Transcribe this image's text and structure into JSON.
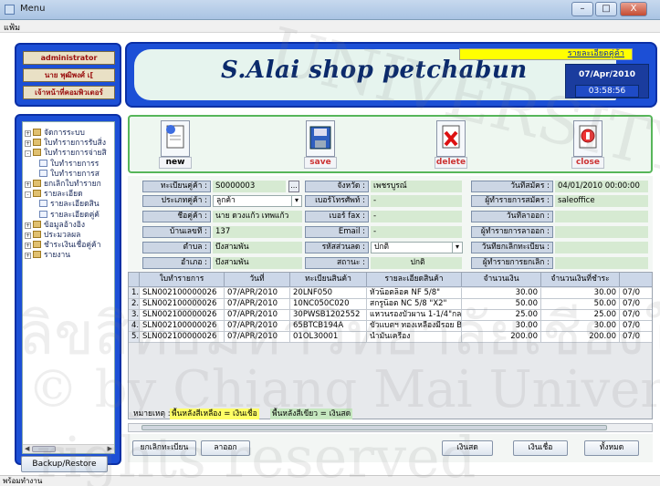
{
  "window": {
    "title": "Menu",
    "menu_item": "แฟ้ม"
  },
  "user_panel": {
    "username": "administrator",
    "fullname": "นาย พุฒิพงศ์ เ[",
    "role": "เจ้าหน้าที่คอมพิวเตอร์"
  },
  "tree": [
    {
      "label": "จัดการระบบ",
      "level": 0,
      "expander": "+",
      "icon": "folder-icon"
    },
    {
      "label": "ใบทำรายการรับสิ่ง",
      "level": 0,
      "expander": "+",
      "icon": "folder-icon"
    },
    {
      "label": "ใบทำรายการจ่ายสิ",
      "level": 0,
      "expander": "-",
      "icon": "folder-icon"
    },
    {
      "label": "ใบทำรายการร",
      "level": 1,
      "expander": "",
      "icon": "document-icon"
    },
    {
      "label": "ใบทำรายการส",
      "level": 1,
      "expander": "",
      "icon": "document-icon"
    },
    {
      "label": "ยกเลิกใบทำรายก",
      "level": 0,
      "expander": "+",
      "icon": "folder-icon"
    },
    {
      "label": "รายละเอียด",
      "level": 0,
      "expander": "-",
      "icon": "folder-icon"
    },
    {
      "label": "รายละเอียดสิน",
      "level": 1,
      "expander": "",
      "icon": "document-icon"
    },
    {
      "label": "รายละเอียดคู่ค้",
      "level": 1,
      "expander": "",
      "icon": "document-icon"
    },
    {
      "label": "ข้อมูลอ้างอิง",
      "level": 0,
      "expander": "+",
      "icon": "folder-icon"
    },
    {
      "label": "ประมวลผล",
      "level": 0,
      "expander": "+",
      "icon": "folder-icon"
    },
    {
      "label": "ชำระเงินเชื่อคู่ค้า",
      "level": 0,
      "expander": "+",
      "icon": "folder-icon"
    },
    {
      "label": "รายงาน",
      "level": 0,
      "expander": "+",
      "icon": "folder-icon"
    }
  ],
  "backup_button": "Backup/Restore",
  "header": {
    "shop_name": "S.Alai shop petchabun",
    "detail_label": "รายละเอียดคู่ค้า",
    "date": "07/Apr/2010",
    "time": "03:58:56"
  },
  "toolbar": {
    "new_label": "new",
    "save_label": "save",
    "delete_label": "delete",
    "close_label": "close"
  },
  "form": {
    "reg_label": "ทะเบียนคู่ค้า :",
    "reg_value": "S0000003",
    "province_label": "จังหวัด :",
    "province_value": "เพชรบูรณ์",
    "apply_date_label": "วันที่สมัคร :",
    "apply_date_value": "04/01/2010 00:00:00",
    "type_label": "ประเภทคู่ค้า :",
    "type_value": "ลูกค้า",
    "phone_label": "เบอร์โทรศัพท์ :",
    "phone_value": "-",
    "apply_by_label": "ผู้ทำรายการสมัคร :",
    "apply_by_value": "saleoffice",
    "name_label": "ชื่อคู่ค้า :",
    "name_value": "นาย ดวงแก้ว เทพแก้ว",
    "fax_label": "เบอร์ fax :",
    "fax_value": "-",
    "leave_date_label": "วันที่ลาออก :",
    "leave_date_value": "",
    "house_no_label": "บ้านเลขที่ :",
    "house_no_value": "137",
    "email_label": "Email :",
    "email_value": "-",
    "leave_by_label": "ผู้ทำรายการลาออก :",
    "leave_by_value": "",
    "subdistrict_label": "ตำบล :",
    "subdistrict_value": "บึงสามพัน",
    "discount_label": "รหัสส่วนลด :",
    "discount_value": "ปกติ",
    "cancel_date_label": "วันที่ยกเลิกทะเบียน :",
    "cancel_date_value": "",
    "district_label": "อำเภอ :",
    "district_value": "บึงสามพัน",
    "status_label": "สถานะ :",
    "status_value": "ปกติ",
    "cancel_by_label": "ผู้ทำรายการยกเลิก :",
    "cancel_by_value": ""
  },
  "grid": {
    "headers": [
      "ใบทำรายการ",
      "วันที่",
      "ทะเบียนสินค้า",
      "รายละเอียดสินค้า",
      "จำนวนเงิน",
      "จำนวนเงินที่ชำระ",
      ""
    ],
    "rows": [
      [
        "1.",
        "SLN002100000026",
        "07/APR/2010",
        "20LNF050",
        "หัวน็อตล็อค NF 5/8\"",
        "30.00",
        "30.00",
        "07/0"
      ],
      [
        "2.",
        "SLN002100000026",
        "07/APR/2010",
        "10NC050C020",
        "สกรูน็อต NC 5/8 \"X2\"",
        "50.00",
        "50.00",
        "07/0"
      ],
      [
        "3.",
        "SLN002100000026",
        "07/APR/2010",
        "30PWSB1202552",
        "แหวนรองบัวผาน 1-1/4\"กลาง",
        "25.00",
        "25.00",
        "07/0"
      ],
      [
        "4.",
        "SLN002100000026",
        "07/APR/2010",
        "65BTCB194A",
        "ขั้วแบตฯ ทองเหลืองมีรอย BHI",
        "30.00",
        "30.00",
        "07/0"
      ],
      [
        "5.",
        "SLN002100000026",
        "07/APR/2010",
        "01OL30001",
        "น้ำมันเครื่อง",
        "200.00",
        "200.00",
        "07/0"
      ]
    ]
  },
  "legend": {
    "note": "หมายเหตุ :",
    "yellow_text": "พื้นหลังสีเหลือง = เงินเชื่อ",
    "green_text": "พื้นหลังสีเขียว = เงินสด"
  },
  "buttons": {
    "cancel_reg": "ยกเลิกทะเบียน",
    "resign": "ลาออก",
    "cash": "เงินสด",
    "credit": "เงินเชื่อ",
    "all": "ทั้งหมด"
  },
  "status": "พร้อมทำงาน",
  "colors": {
    "panel_blue": "#1c4fd6",
    "header_yellow": "#ffff00",
    "form_green": "#d6ead2",
    "toolbar_border": "#57b65a"
  }
}
